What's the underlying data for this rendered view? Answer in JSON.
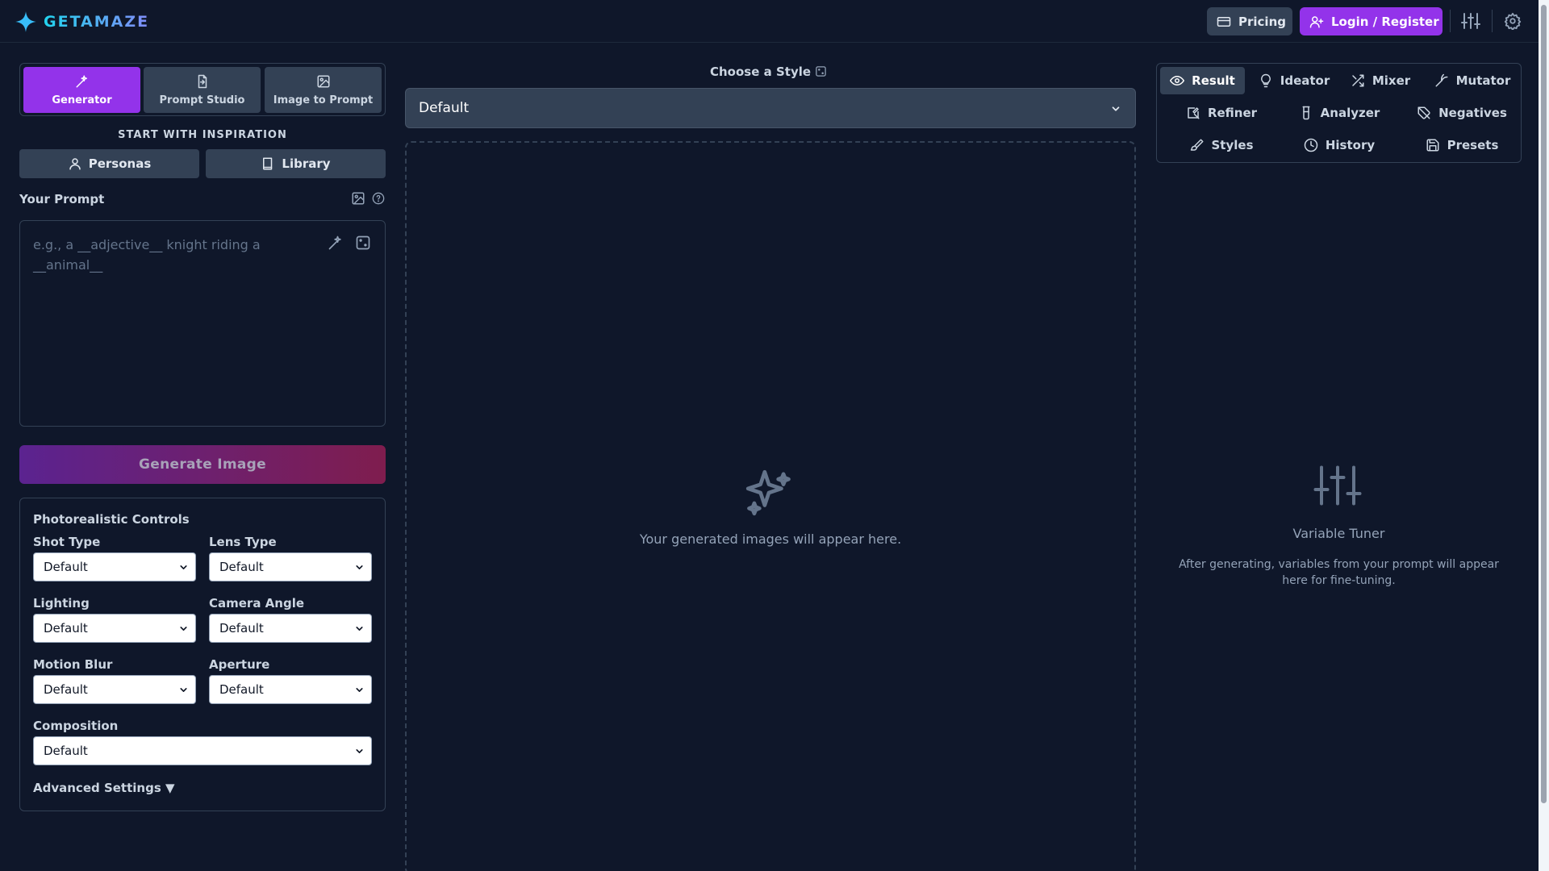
{
  "header": {
    "brand": "GETAMAZE",
    "pricing_label": "Pricing",
    "login_label": "Login / Register"
  },
  "modes": [
    {
      "label": "Generator",
      "icon": "magic-wand-icon",
      "active": true
    },
    {
      "label": "Prompt Studio",
      "icon": "document-swap-icon",
      "active": false
    },
    {
      "label": "Image to Prompt",
      "icon": "image-icon",
      "active": false
    }
  ],
  "inspiration": {
    "title": "START WITH INSPIRATION",
    "personas_label": "Personas",
    "library_label": "Library"
  },
  "prompt": {
    "label": "Your Prompt",
    "value": "",
    "placeholder": "e.g., a __adjective__ knight riding a __animal__"
  },
  "generate_label": "Generate Image",
  "controls": {
    "title": "Photorealistic Controls",
    "fields": [
      {
        "label": "Shot Type",
        "value": "Default"
      },
      {
        "label": "Lens Type",
        "value": "Default"
      },
      {
        "label": "Lighting",
        "value": "Default"
      },
      {
        "label": "Camera Angle",
        "value": "Default"
      },
      {
        "label": "Motion Blur",
        "value": "Default"
      },
      {
        "label": "Aperture",
        "value": "Default"
      },
      {
        "label": "Composition",
        "value": "Default"
      }
    ],
    "advanced_label": "Advanced Settings ▼"
  },
  "style": {
    "title": "Choose a Style",
    "selected": "Default"
  },
  "result": {
    "empty_text": "Your generated images will appear here."
  },
  "tools": [
    {
      "label": "Result",
      "icon": "eye-icon",
      "active": true
    },
    {
      "label": "Ideator",
      "icon": "lightbulb-icon",
      "active": false
    },
    {
      "label": "Mixer",
      "icon": "shuffle-icon",
      "active": false
    },
    {
      "label": "Mutator",
      "icon": "mutate-icon",
      "active": false
    },
    {
      "label": "Refiner",
      "icon": "refine-icon",
      "active": false
    },
    {
      "label": "Analyzer",
      "icon": "beaker-icon",
      "active": false
    },
    {
      "label": "Negatives",
      "icon": "tag-off-icon",
      "active": false
    },
    {
      "label": "Styles",
      "icon": "brush-icon",
      "active": false
    },
    {
      "label": "History",
      "icon": "clock-icon",
      "active": false
    },
    {
      "label": "Presets",
      "icon": "save-icon",
      "active": false
    }
  ],
  "tuner": {
    "title": "Variable Tuner",
    "description": "After generating, variables from your prompt will appear here for fine-tuning."
  },
  "colors": {
    "background": "#0f172a",
    "accent": "#9333ea",
    "brand": "#38bdf8",
    "surface": "#334155"
  }
}
